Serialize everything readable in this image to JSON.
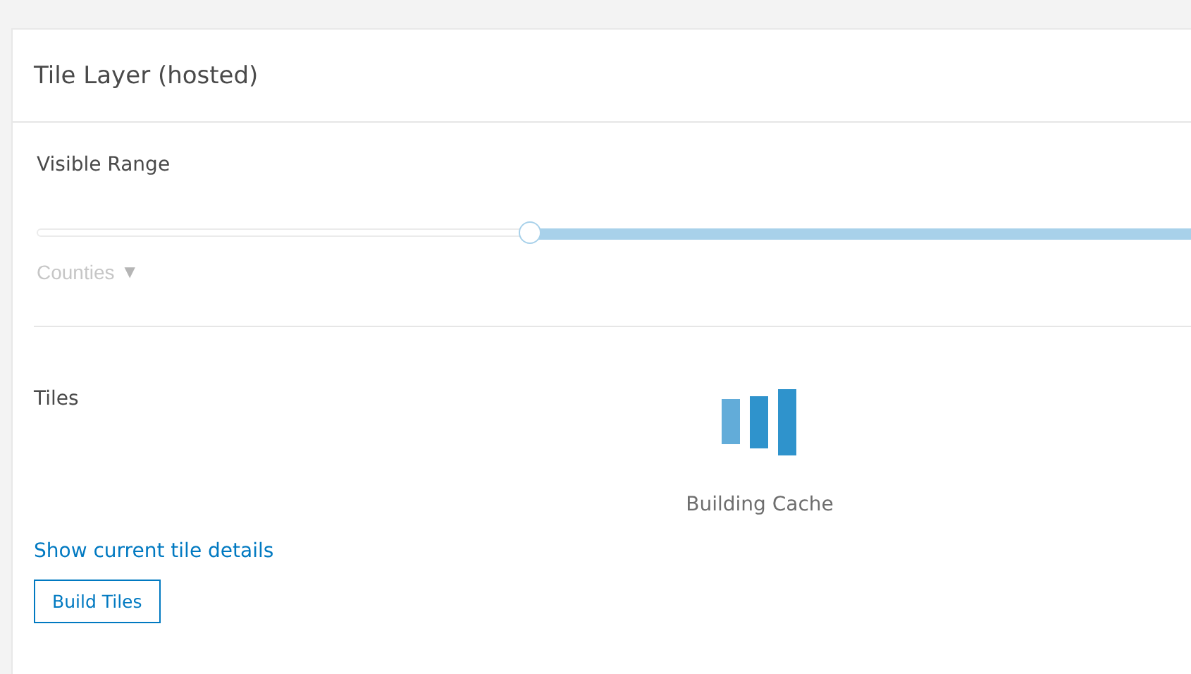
{
  "panel": {
    "title": "Tile Layer (hosted)"
  },
  "visible_range": {
    "label": "Visible Range",
    "scale": "Counties",
    "scale_caret": "▼"
  },
  "tiles": {
    "label": "Tiles",
    "status": "Building Cache",
    "link": "Show current tile details",
    "button": "Build Tiles"
  }
}
